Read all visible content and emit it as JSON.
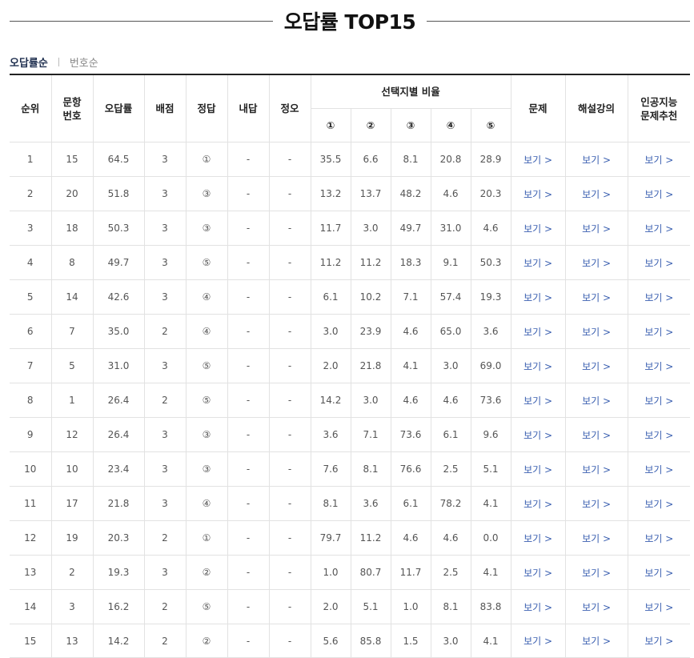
{
  "title": "오답률 TOP15",
  "sort_tabs": {
    "active": "오답률순",
    "other": "번호순"
  },
  "columns": {
    "rank": "순위",
    "question_no": "문항\n번호",
    "error_rate": "오답률",
    "points": "배점",
    "answer": "정답",
    "my_answer": "내답",
    "correct_wrong": "정오",
    "choice_ratio": "선택지별 비율",
    "choices": [
      "①",
      "②",
      "③",
      "④",
      "⑤"
    ],
    "problem": "문제",
    "lecture": "해설강의",
    "ai": "인공지능\n문제추천"
  },
  "link_label": "보기 >",
  "rows": [
    {
      "rank": "1",
      "no": "15",
      "rate": "64.5",
      "pts": "3",
      "ans": "①",
      "mine": "-",
      "ox": "-",
      "r": [
        "35.5",
        "6.6",
        "8.1",
        "20.8",
        "28.9"
      ]
    },
    {
      "rank": "2",
      "no": "20",
      "rate": "51.8",
      "pts": "3",
      "ans": "③",
      "mine": "-",
      "ox": "-",
      "r": [
        "13.2",
        "13.7",
        "48.2",
        "4.6",
        "20.3"
      ]
    },
    {
      "rank": "3",
      "no": "18",
      "rate": "50.3",
      "pts": "3",
      "ans": "③",
      "mine": "-",
      "ox": "-",
      "r": [
        "11.7",
        "3.0",
        "49.7",
        "31.0",
        "4.6"
      ]
    },
    {
      "rank": "4",
      "no": "8",
      "rate": "49.7",
      "pts": "3",
      "ans": "⑤",
      "mine": "-",
      "ox": "-",
      "r": [
        "11.2",
        "11.2",
        "18.3",
        "9.1",
        "50.3"
      ]
    },
    {
      "rank": "5",
      "no": "14",
      "rate": "42.6",
      "pts": "3",
      "ans": "④",
      "mine": "-",
      "ox": "-",
      "r": [
        "6.1",
        "10.2",
        "7.1",
        "57.4",
        "19.3"
      ]
    },
    {
      "rank": "6",
      "no": "7",
      "rate": "35.0",
      "pts": "2",
      "ans": "④",
      "mine": "-",
      "ox": "-",
      "r": [
        "3.0",
        "23.9",
        "4.6",
        "65.0",
        "3.6"
      ]
    },
    {
      "rank": "7",
      "no": "5",
      "rate": "31.0",
      "pts": "3",
      "ans": "⑤",
      "mine": "-",
      "ox": "-",
      "r": [
        "2.0",
        "21.8",
        "4.1",
        "3.0",
        "69.0"
      ]
    },
    {
      "rank": "8",
      "no": "1",
      "rate": "26.4",
      "pts": "2",
      "ans": "⑤",
      "mine": "-",
      "ox": "-",
      "r": [
        "14.2",
        "3.0",
        "4.6",
        "4.6",
        "73.6"
      ]
    },
    {
      "rank": "9",
      "no": "12",
      "rate": "26.4",
      "pts": "3",
      "ans": "③",
      "mine": "-",
      "ox": "-",
      "r": [
        "3.6",
        "7.1",
        "73.6",
        "6.1",
        "9.6"
      ]
    },
    {
      "rank": "10",
      "no": "10",
      "rate": "23.4",
      "pts": "3",
      "ans": "③",
      "mine": "-",
      "ox": "-",
      "r": [
        "7.6",
        "8.1",
        "76.6",
        "2.5",
        "5.1"
      ]
    },
    {
      "rank": "11",
      "no": "17",
      "rate": "21.8",
      "pts": "3",
      "ans": "④",
      "mine": "-",
      "ox": "-",
      "r": [
        "8.1",
        "3.6",
        "6.1",
        "78.2",
        "4.1"
      ]
    },
    {
      "rank": "12",
      "no": "19",
      "rate": "20.3",
      "pts": "2",
      "ans": "①",
      "mine": "-",
      "ox": "-",
      "r": [
        "79.7",
        "11.2",
        "4.6",
        "4.6",
        "0.0"
      ]
    },
    {
      "rank": "13",
      "no": "2",
      "rate": "19.3",
      "pts": "3",
      "ans": "②",
      "mine": "-",
      "ox": "-",
      "r": [
        "1.0",
        "80.7",
        "11.7",
        "2.5",
        "4.1"
      ]
    },
    {
      "rank": "14",
      "no": "3",
      "rate": "16.2",
      "pts": "2",
      "ans": "⑤",
      "mine": "-",
      "ox": "-",
      "r": [
        "2.0",
        "5.1",
        "1.0",
        "8.1",
        "83.8"
      ]
    },
    {
      "rank": "15",
      "no": "13",
      "rate": "14.2",
      "pts": "2",
      "ans": "②",
      "mine": "-",
      "ox": "-",
      "r": [
        "5.6",
        "85.8",
        "1.5",
        "3.0",
        "4.1"
      ]
    }
  ],
  "colors": {
    "link": "#3a5fb0",
    "border_top": "#222222",
    "cell_border": "#e2e2e2"
  }
}
